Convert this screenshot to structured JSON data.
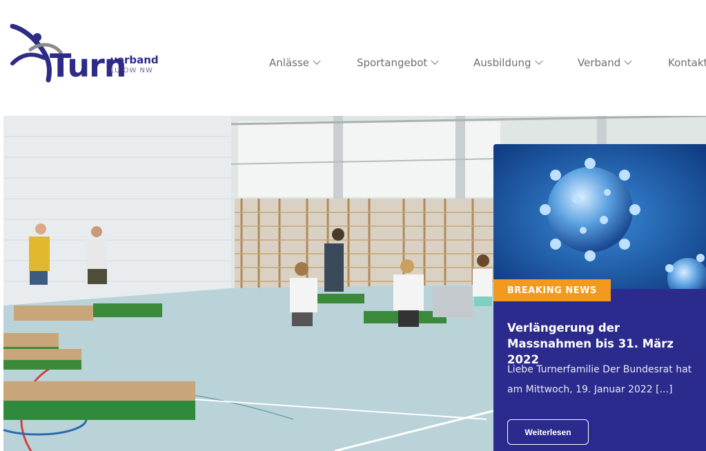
{
  "logo": {
    "word": "Turn",
    "sub1": "verband",
    "sub2": "LU OW NW"
  },
  "nav": {
    "items": [
      {
        "label": "Anlässe"
      },
      {
        "label": "Sportangebot"
      },
      {
        "label": "Ausbildung"
      },
      {
        "label": "Verband"
      },
      {
        "label": "Kontakt"
      }
    ]
  },
  "hero": {
    "image_subject": "gym-children-playing"
  },
  "news": {
    "badge": "BREAKING NEWS",
    "title": "Verlängerung der Massnahmen bis 31. März 2022",
    "text": "Liebe Turnerfamilie Der Bundesrat hat am Mittwoch, 19. Januar 2022 [...]",
    "button": "Weiterlesen"
  },
  "colors": {
    "brand": "#2d2b86",
    "card": "#2b2b8e",
    "badge": "#f39a1e"
  }
}
